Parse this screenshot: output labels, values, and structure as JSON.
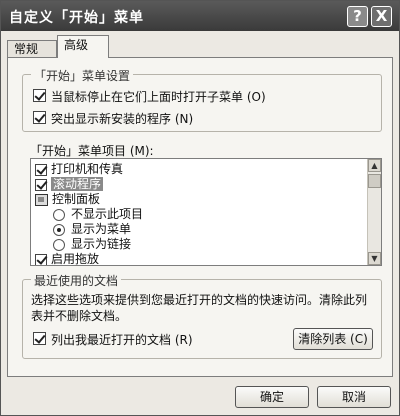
{
  "window": {
    "title": "自定义「开始」菜单",
    "help_button": "?",
    "close_button": "X"
  },
  "tabs": [
    {
      "label": "常规",
      "active": false
    },
    {
      "label": "高级",
      "active": true
    }
  ],
  "start_menu_settings": {
    "group_title": "「开始」菜单设置",
    "options": [
      {
        "label": "当鼠标停止在它们上面时打开子菜单 (O)",
        "checked": true
      },
      {
        "label": "突出显示新安装的程序 (N)",
        "checked": true
      }
    ]
  },
  "start_menu_items": {
    "label": "「开始」菜单项目 (M):",
    "items": [
      {
        "type": "checkbox",
        "label": "打印机和传真",
        "checked": true
      },
      {
        "type": "checkbox",
        "label": "滚动程序",
        "checked": true,
        "highlighted": true
      },
      {
        "type": "header",
        "label": "控制面板",
        "icon": "control-panel-icon"
      },
      {
        "type": "radio",
        "label": "不显示此项目",
        "selected": false
      },
      {
        "type": "radio",
        "label": "显示为菜单",
        "selected": true
      },
      {
        "type": "radio",
        "label": "显示为链接",
        "selected": false
      },
      {
        "type": "checkbox",
        "label": "启用拖放",
        "checked": true
      }
    ]
  },
  "recent_documents": {
    "group_title": "最近使用的文档",
    "description": "选择这些选项来提供到您最近打开的文档的快速访问。清除此列表并不删除文档。",
    "list_recent_label": "列出我最近打开的文档 (R)",
    "list_recent_checked": true,
    "clear_button": "清除列表 (C)"
  },
  "footer": {
    "ok_button": "确定",
    "cancel_button": "取消"
  }
}
